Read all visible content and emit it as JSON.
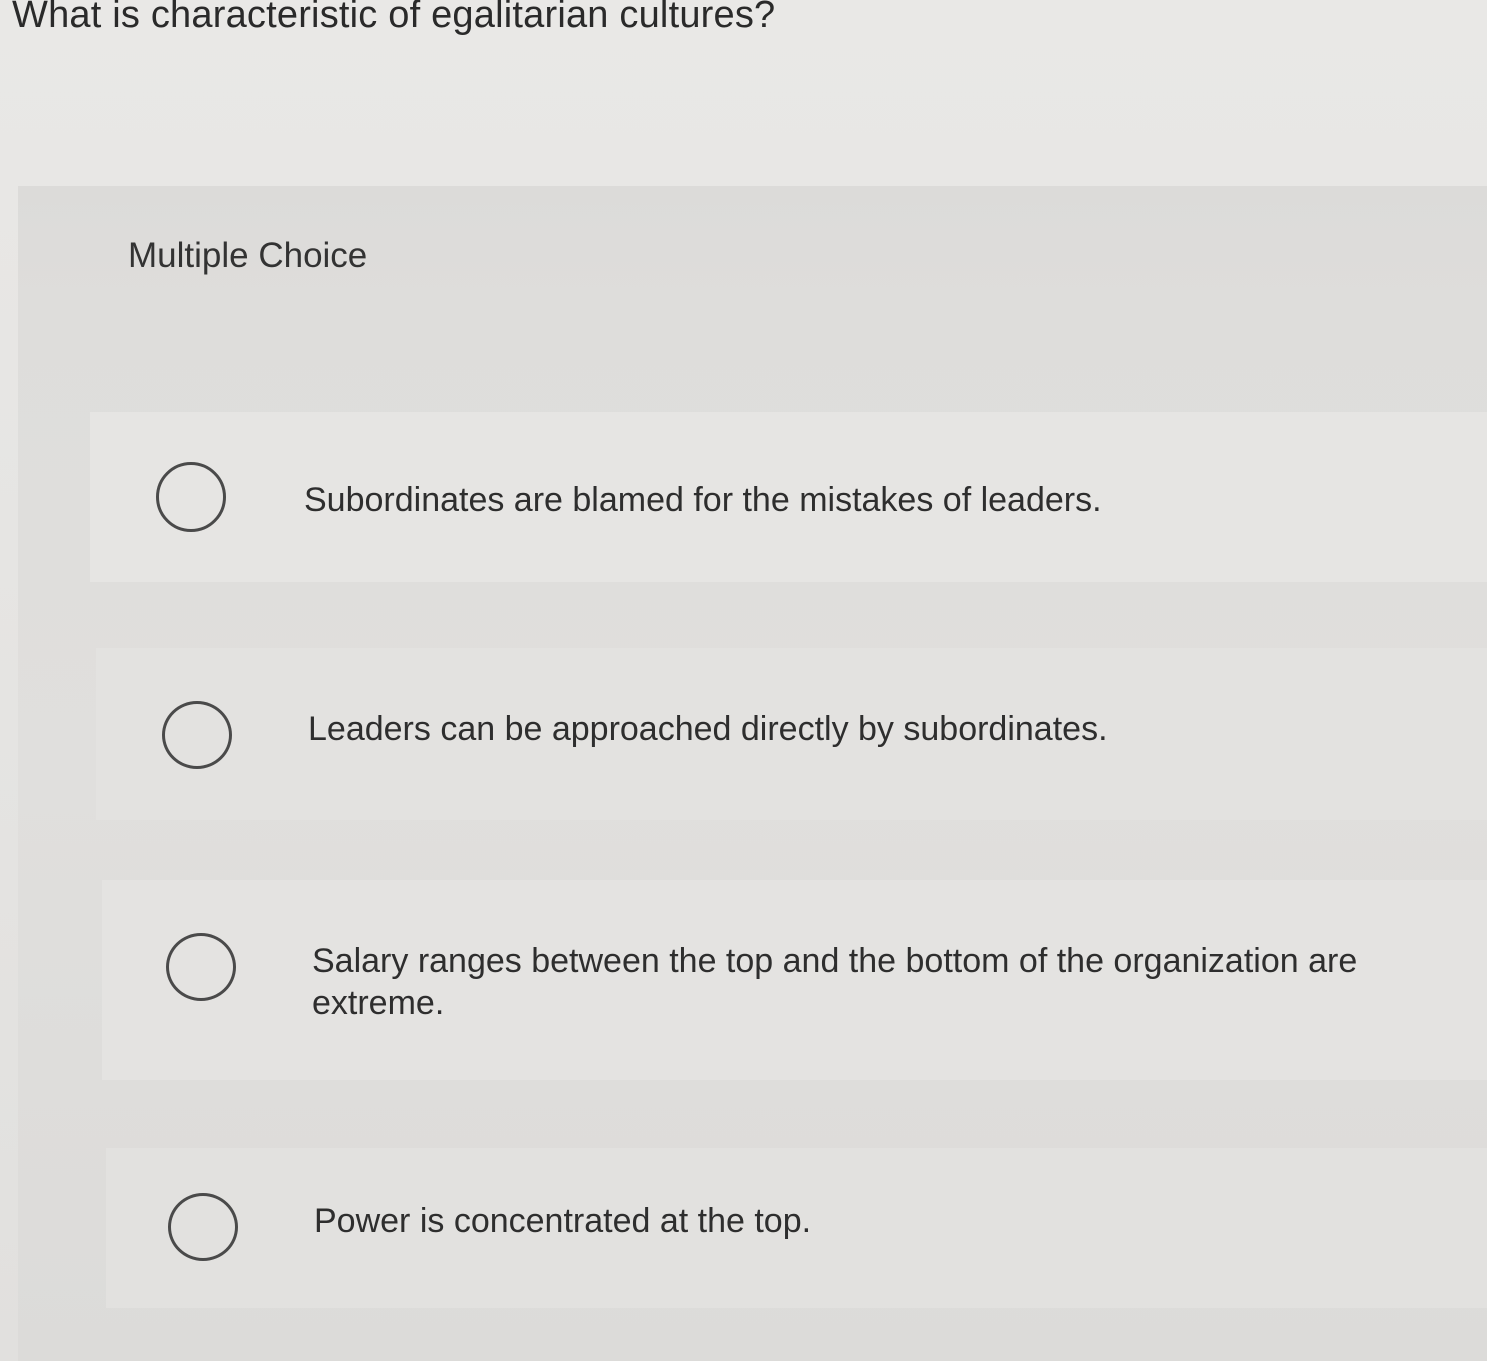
{
  "question": {
    "title": "What is characteristic of egalitarian cultures?"
  },
  "panel": {
    "type_label": "Multiple Choice"
  },
  "choices": [
    {
      "label": "Subordinates are blamed for the mistakes of leaders.",
      "selected": false
    },
    {
      "label": "Leaders can be approached directly by subordinates.",
      "selected": false
    },
    {
      "label": "Salary ranges between the top and the bottom of the organization are extreme.",
      "selected": false
    },
    {
      "label": "Power is concentrated at the top.",
      "selected": false
    }
  ]
}
